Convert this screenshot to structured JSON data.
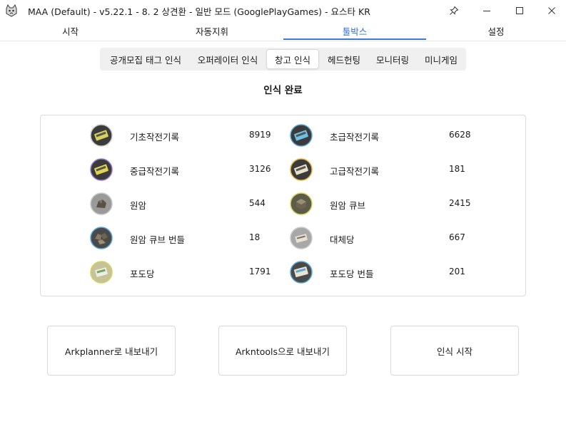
{
  "window": {
    "title": "MAA (Default) - v5.22.1 -  8. 2 상견환 - 일반 모드 (GooglePlayGames) - 요스타 KR"
  },
  "main_tabs": [
    {
      "label": "시작"
    },
    {
      "label": "자동지휘"
    },
    {
      "label": "툴박스"
    },
    {
      "label": "설정"
    }
  ],
  "sub_tabs": [
    {
      "label": "공개모집 태그 인식"
    },
    {
      "label": "오퍼레이터 인식"
    },
    {
      "label": "창고 인식"
    },
    {
      "label": "헤드헌팅"
    },
    {
      "label": "모니터링"
    },
    {
      "label": "미니게임"
    }
  ],
  "status": "인식 완료",
  "items": [
    {
      "name": "기초작전기록",
      "count": "8919"
    },
    {
      "name": "초급작전기록",
      "count": "6628"
    },
    {
      "name": "중급작전기록",
      "count": "3126"
    },
    {
      "name": "고급작전기록",
      "count": "181"
    },
    {
      "name": "원암",
      "count": "544"
    },
    {
      "name": "원암 큐브",
      "count": "2415"
    },
    {
      "name": "원암 큐브 번들",
      "count": "18"
    },
    {
      "name": "대체당",
      "count": "667"
    },
    {
      "name": "포도당",
      "count": "1791"
    },
    {
      "name": "포도당 번들",
      "count": "201"
    }
  ],
  "actions": {
    "arkplanner": "Arkplanner로 내보내기",
    "arkntools": "Arkntools으로 내보내기",
    "start": "인식 시작"
  },
  "colors": {
    "accent": "#3a7ae0",
    "active_tab_text": "#2f6fd6"
  }
}
